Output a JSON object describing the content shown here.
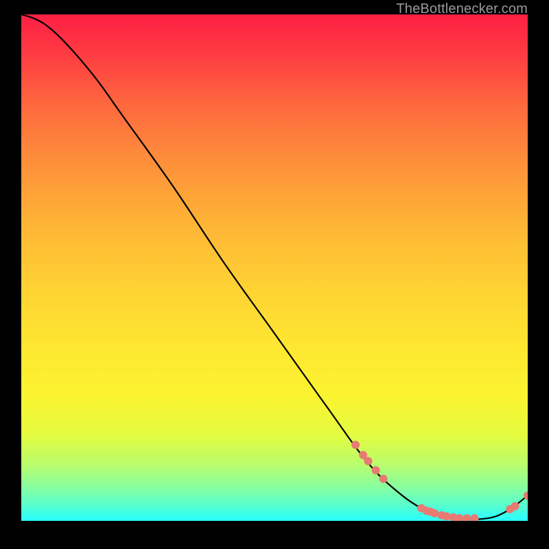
{
  "watermark": "TheBottlenecker.com",
  "chart_data": {
    "type": "line",
    "title": "",
    "xlabel": "",
    "ylabel": "",
    "xlim": [
      0,
      100
    ],
    "ylim": [
      0,
      100
    ],
    "curve": [
      {
        "x": 0,
        "y": 100
      },
      {
        "x": 3,
        "y": 99
      },
      {
        "x": 6,
        "y": 97
      },
      {
        "x": 10,
        "y": 93
      },
      {
        "x": 15,
        "y": 87
      },
      {
        "x": 20,
        "y": 80
      },
      {
        "x": 30,
        "y": 66
      },
      {
        "x": 40,
        "y": 51
      },
      {
        "x": 50,
        "y": 37
      },
      {
        "x": 60,
        "y": 23
      },
      {
        "x": 68,
        "y": 12
      },
      {
        "x": 74,
        "y": 6
      },
      {
        "x": 80,
        "y": 2
      },
      {
        "x": 86,
        "y": 0.5
      },
      {
        "x": 92,
        "y": 0.5
      },
      {
        "x": 96,
        "y": 2
      },
      {
        "x": 100,
        "y": 5
      }
    ],
    "markers": [
      {
        "x": 66,
        "y": 15
      },
      {
        "x": 67.5,
        "y": 13
      },
      {
        "x": 68.5,
        "y": 11.8
      },
      {
        "x": 70,
        "y": 10
      },
      {
        "x": 71.5,
        "y": 8.3
      },
      {
        "x": 79,
        "y": 2.5
      },
      {
        "x": 80,
        "y": 2
      },
      {
        "x": 80.8,
        "y": 1.8
      },
      {
        "x": 81.6,
        "y": 1.5
      },
      {
        "x": 83,
        "y": 1.1
      },
      {
        "x": 84,
        "y": 0.9
      },
      {
        "x": 85.3,
        "y": 0.7
      },
      {
        "x": 86.5,
        "y": 0.55
      },
      {
        "x": 88,
        "y": 0.5
      },
      {
        "x": 89.5,
        "y": 0.5
      },
      {
        "x": 96.5,
        "y": 2.3
      },
      {
        "x": 97.5,
        "y": 2.9
      },
      {
        "x": 100,
        "y": 5
      }
    ],
    "marker_color": "#e77a72",
    "marker_radius": 6,
    "line_color": "#000000"
  }
}
